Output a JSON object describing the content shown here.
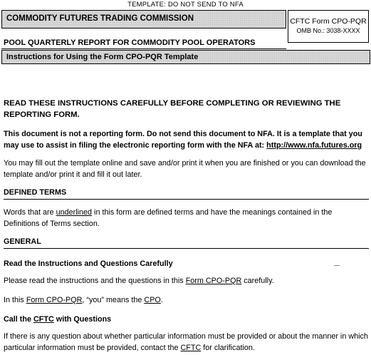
{
  "template_notice": "TEMPLATE: DO NOT SEND TO NFA",
  "commission_name": "COMMODITY FUTURES TRADING COMMISSION",
  "form_box": {
    "form_name": "CFTC Form CPO-PQR",
    "omb_number": "OMB No.: 3038-XXXX"
  },
  "report_title": "POOL QUARTERLY REPORT FOR COMMODITY POOL OPERATORS",
  "instructions_header": "Instructions for Using the Form CPO-PQR Template",
  "intro": {
    "read_carefully": "READ THESE INSTRUCTIONS CAREFULLY BEFORE COMPLETING OR REVIEWING THE REPORTING FORM.",
    "not_form_text": "This document is not a reporting form.  Do not send this document to NFA.  It is a template that you may use to assist in filing the electronic reporting form with the NFA at: ",
    "nfa_link": "http://www.nfa.futures.org",
    "fill_out": "You may fill out the template online and save and/or print it when you are finished or you can download the template and/or print it and fill it out later."
  },
  "defined_terms": {
    "heading": "DEFINED TERMS",
    "text_before": "Words that are ",
    "underlined_word": "underlined",
    "text_after": " in this form are defined terms and have the meanings contained in the Definitions of Terms section."
  },
  "general": {
    "heading": "GENERAL",
    "read_heading": "Read the Instructions and Questions Carefully",
    "read_text_before": "Please read the instructions and the questions in this ",
    "read_link": "Form CPO-PQR",
    "read_text_after": " carefully.",
    "you_text_1": "In this ",
    "you_link_form": "Form CPO-PQR",
    "you_text_2": ", “you” means the ",
    "you_link_cpo": "CPO",
    "you_text_3": ".",
    "call_heading_before": "Call the ",
    "call_heading_link": "CFTC",
    "call_heading_after": " with Questions",
    "call_text_before": "If there is any question about whether particular information must be provided or about the manner in which particular information must be provided, contact the ",
    "call_text_link": "CFTC",
    "call_text_after": " for clarification."
  }
}
